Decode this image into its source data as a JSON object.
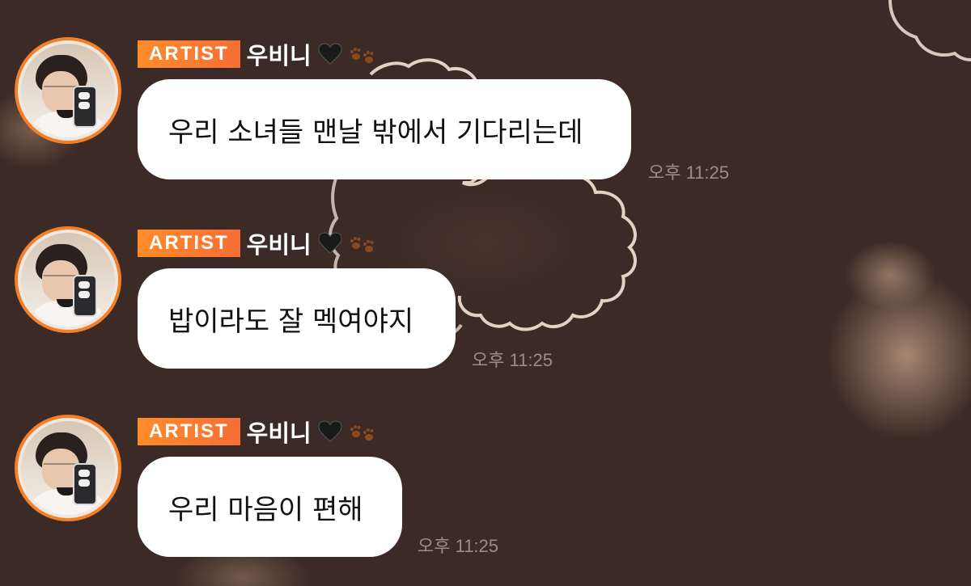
{
  "messages": [
    {
      "badge": "ARTIST",
      "sender": "우비니",
      "heart_icon": "black-heart-icon",
      "paw_icon": "paw-prints-icon",
      "text": "우리 소녀들 맨날 밖에서 기다리는데",
      "time": "오후 11:25"
    },
    {
      "badge": "ARTIST",
      "sender": "우비니",
      "heart_icon": "black-heart-icon",
      "paw_icon": "paw-prints-icon",
      "text": "밥이라도 잘 멕여야지",
      "time": "오후 11:25"
    },
    {
      "badge": "ARTIST",
      "sender": "우비니",
      "heart_icon": "black-heart-icon",
      "paw_icon": "paw-prints-icon",
      "text": "우리 마음이 편해",
      "time": "오후 11:25"
    }
  ],
  "colors": {
    "background": "#3b2a25",
    "badge": "#f77a2e",
    "avatar_ring": "#f37f29",
    "bubble": "#ffffff",
    "timestamp": "#9a8e89"
  }
}
